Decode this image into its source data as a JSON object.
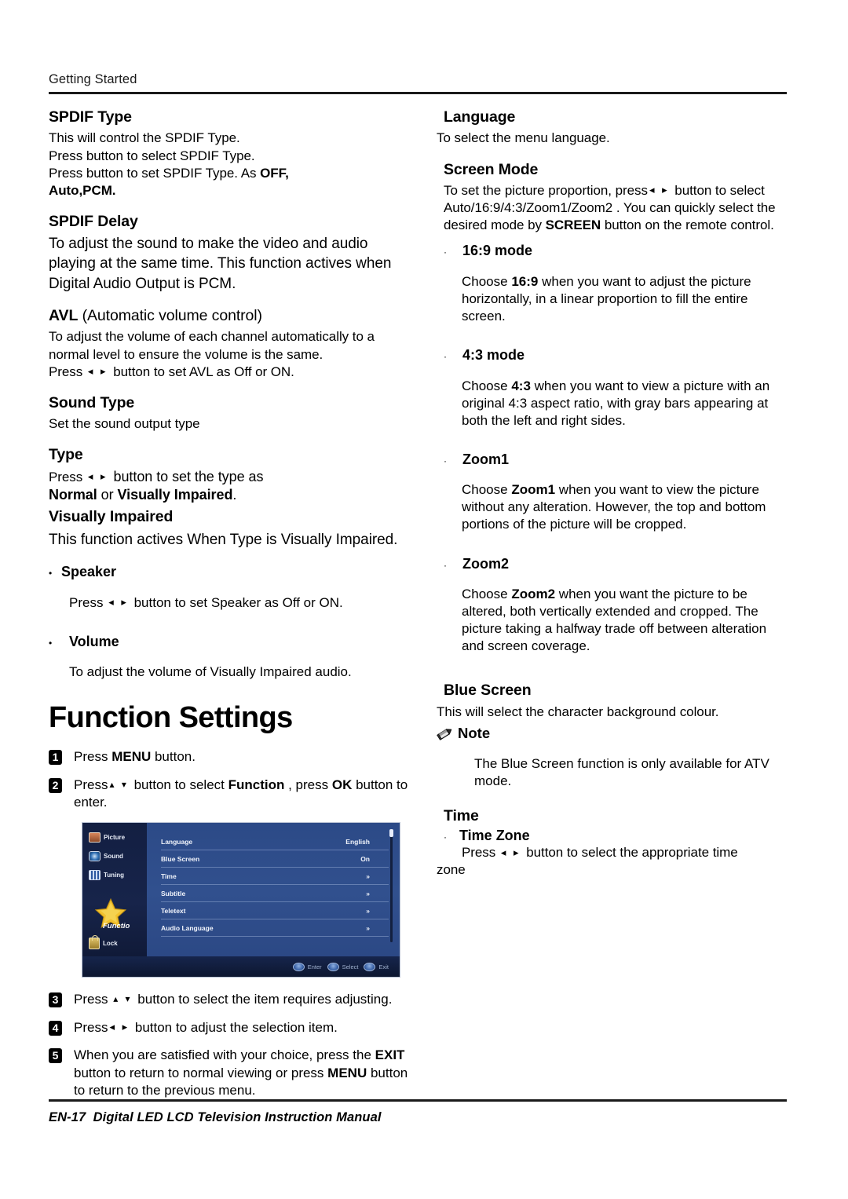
{
  "header": {
    "running_title": "Getting Started"
  },
  "footer": {
    "page_number": "EN-17",
    "manual_title": "Digital LED LCD Television Instruction Manual"
  },
  "left_column": {
    "spdif_type": {
      "heading": "SPDIF Type",
      "line1": "This will control the SPDIF Type.",
      "line2": "Press button to select SPDIF Type.",
      "line3_a": "Press button to set SPDIF Type.  As ",
      "line3_b": "OFF,",
      "line4": "Auto,PCM."
    },
    "spdif_delay": {
      "heading": "SPDIF Delay",
      "body": "To adjust the sound to make the video and audio playing at the same time. This function actives when Digital Audio Output is PCM."
    },
    "avl": {
      "heading_bold": "AVL",
      "heading_rest": " (Automatic volume control)",
      "body1": "To adjust the volume of each channel automatically to a normal level to ensure the volume is the same.",
      "press_prefix": "Press ",
      "arrows": "◂ ▸",
      "press_suffix": " button to set AVL as Off or ON."
    },
    "sound_type": {
      "heading": "Sound Type",
      "body": "Set the sound output type"
    },
    "type": {
      "heading": "Type",
      "press_prefix": "Press ",
      "arrows": "◂ ▸",
      "press_suffix": " button to set the type as",
      "line2_a": "Normal",
      "line2_b": " or ",
      "line2_c": "Visually Impaired",
      "line2_d": "."
    },
    "visually_impaired": {
      "heading": "Visually Impaired",
      "body": "This function actives When Type is Visually Impaired."
    },
    "speaker": {
      "bullet": "•",
      "heading": "Speaker",
      "press_prefix": "Press ",
      "arrows": "◂ ▸",
      "press_suffix": " button to set Speaker as Off or ON."
    },
    "volume": {
      "bullet": "•",
      "heading": "Volume",
      "body": "To adjust the volume of Visually Impaired audio."
    },
    "function_settings": {
      "title": "Function Settings",
      "steps": [
        {
          "num": "1",
          "text_a": "Press ",
          "text_b": "MENU",
          "text_c": " button."
        },
        {
          "num": "2",
          "text_a": "Press",
          "arrows": "▴ ▾",
          "text_b": " button to select ",
          "text_c": "Function",
          "text_d": " , press ",
          "text_e": "OK",
          "text_f": " button to enter."
        },
        {
          "num": "3",
          "text_a": "Press ",
          "arrows": "▴ ▾",
          "text_b": " button to select the item requires adjusting."
        },
        {
          "num": "4",
          "text_a": "Press",
          "arrows": "◂ ▸",
          "text_b": " button to adjust the selection item."
        },
        {
          "num": "5",
          "text_a": "When you are satisfied with your choice, press the ",
          "text_b": "EXIT",
          "text_c": " button to return to normal viewing or press ",
          "text_d": "MENU",
          "text_e": " button to return to the previous menu."
        }
      ]
    }
  },
  "tv_menu": {
    "sidebar": [
      {
        "label": "Picture",
        "icon": "picture-icon"
      },
      {
        "label": "Sound",
        "icon": "speaker-icon"
      },
      {
        "label": "Tuning",
        "icon": "tuning-icon"
      },
      {
        "label": "Functio",
        "icon": "star-icon",
        "selected": true
      },
      {
        "label": "Lock",
        "icon": "lock-icon"
      }
    ],
    "rows": [
      {
        "label": "Language",
        "value": "English"
      },
      {
        "label": "Blue Screen",
        "value": "On"
      },
      {
        "label": "Time",
        "value": "»"
      },
      {
        "label": "Subtitle",
        "value": "»"
      },
      {
        "label": "Teletext",
        "value": "»"
      },
      {
        "label": "Audio Language",
        "value": "»"
      }
    ],
    "bottom_buttons": [
      {
        "label": "Enter"
      },
      {
        "label": "Select"
      },
      {
        "label": "Exit"
      }
    ]
  },
  "right_column": {
    "language": {
      "heading": "Language",
      "body": "To select the menu language."
    },
    "screen_mode": {
      "heading": "Screen Mode",
      "body_a": "To set the picture proportion, press",
      "arrows": "◂ ▸",
      "body_b": " button to select Auto/16:9/4:3/Zoom1/Zoom2 . You can quickly select the desired mode by ",
      "body_c": "SCREEN",
      "body_d": " button on the remote control."
    },
    "modes": [
      {
        "bullet": "·",
        "heading": "16:9 mode",
        "body_a": "Choose ",
        "body_b": "16:9",
        "body_c": " when you want to adjust the picture horizontally, in a linear proportion to fill the entire screen."
      },
      {
        "bullet": "·",
        "heading": "4:3 mode",
        "body_a": "Choose ",
        "body_b": "4:3",
        "body_c": " when you want to view a picture with an original 4:3 aspect ratio, with gray bars appearing at both the left and right sides."
      },
      {
        "bullet": "·",
        "heading": "Zoom1",
        "body_a": "Choose ",
        "body_b": "Zoom1",
        "body_c": " when you want to view the picture without any alteration. However, the top and bottom portions of the picture will be cropped."
      },
      {
        "bullet": "·",
        "heading": "Zoom2",
        "body_a": "Choose ",
        "body_b": "Zoom2",
        "body_c": " when you want the picture to be altered, both vertically extended and cropped. The picture taking a halfway trade off between alteration and screen coverage."
      }
    ],
    "blue_screen": {
      "heading": "Blue Screen",
      "body": "This will select the character background colour."
    },
    "note": {
      "title": "Note",
      "body": "The Blue Screen function is only available for ATV mode."
    },
    "time": {
      "heading": "Time",
      "bullet": "·",
      "sub_heading": "Time Zone",
      "press_prefix": "Press ",
      "arrows": "◂ ▸",
      "press_suffix": " button to select the appropriate time",
      "wrap_word": "zone"
    }
  }
}
